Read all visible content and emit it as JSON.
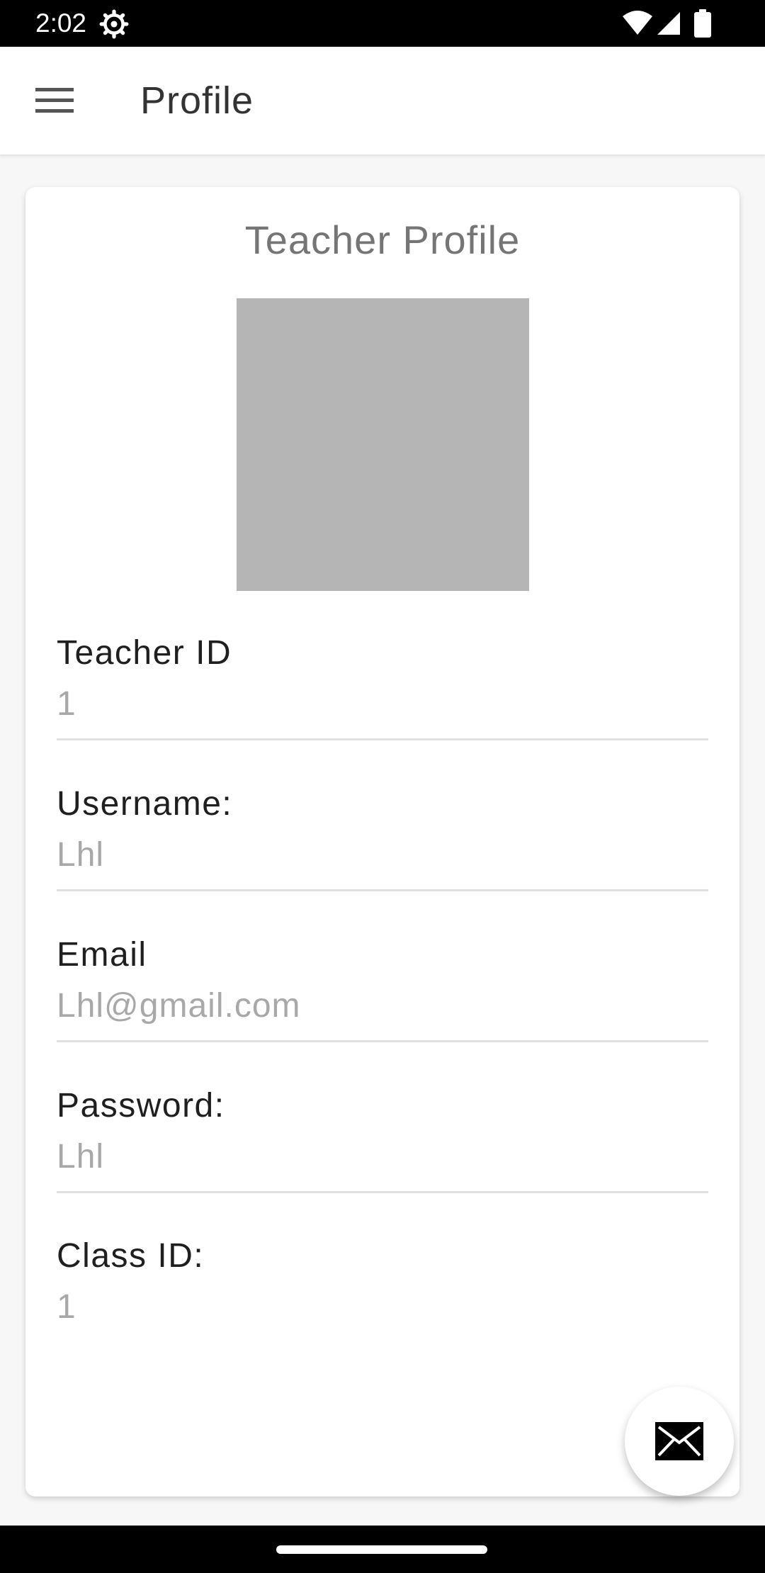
{
  "status_bar": {
    "time": "2:02",
    "icons": [
      "gear-icon",
      "wifi-icon",
      "cell-signal-icon",
      "battery-icon"
    ]
  },
  "app_bar": {
    "title": "Profile",
    "menu_icon": "menu-icon"
  },
  "card": {
    "title": "Teacher Profile",
    "fields": [
      {
        "label": "Teacher ID",
        "value": "1"
      },
      {
        "label": "Username:",
        "value": "Lhl"
      },
      {
        "label": "Email",
        "value": "Lhl@gmail.com"
      },
      {
        "label": "Password:",
        "value": "Lhl"
      },
      {
        "label": "Class ID:",
        "value": "1"
      }
    ]
  },
  "fab": {
    "icon": "mail-icon"
  },
  "colors": {
    "status_bar": "#000000",
    "card_title": "#757575",
    "field_value": "#a8a8a8",
    "avatar_placeholder": "#b5b5b5"
  }
}
